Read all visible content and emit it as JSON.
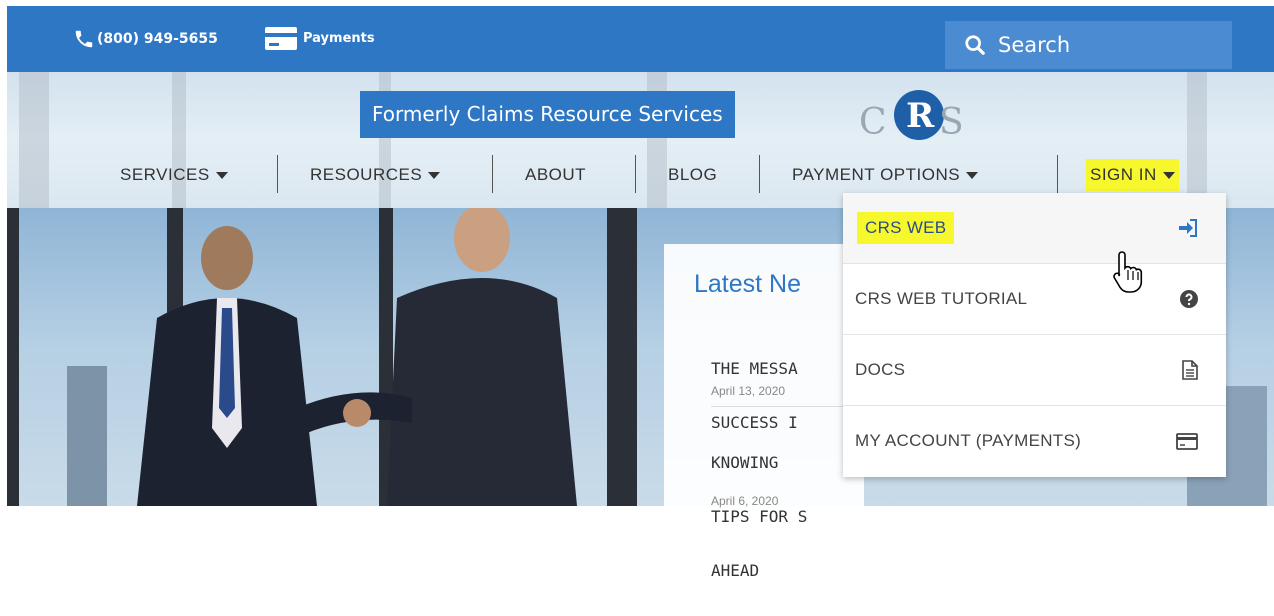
{
  "topbar": {
    "phone": "(800) 949-5655",
    "payments_label": "Payments",
    "search_label": "Search"
  },
  "header": {
    "tagline": "Formerly Claims Resource Services",
    "logo_letters": [
      "C",
      "R",
      "S"
    ]
  },
  "nav": {
    "items": [
      {
        "label": "SERVICES",
        "dropdown": true
      },
      {
        "label": "RESOURCES",
        "dropdown": true
      },
      {
        "label": "ABOUT",
        "dropdown": false
      },
      {
        "label": "BLOG",
        "dropdown": false
      },
      {
        "label": "PAYMENT OPTIONS",
        "dropdown": true
      },
      {
        "label": "SIGN IN",
        "dropdown": true
      }
    ]
  },
  "news": {
    "title": "Latest Ne",
    "items": [
      {
        "line1": "THE MESSA",
        "line2": "SUCCESS I",
        "date": "April 13, 2020"
      },
      {
        "line1": "KNOWING ",
        "line2": "TIPS FOR S",
        "line3": "AHEAD",
        "date": "April 6, 2020"
      }
    ]
  },
  "signin_menu": {
    "items": [
      {
        "label": "CRS WEB",
        "icon": "sign-in-icon"
      },
      {
        "label": "CRS WEB TUTORIAL",
        "icon": "question-circle-icon"
      },
      {
        "label": "DOCS",
        "icon": "document-icon"
      },
      {
        "label": "MY ACCOUNT (PAYMENTS)",
        "icon": "credit-card-icon"
      }
    ]
  },
  "colors": {
    "brand_blue": "#2e77c4",
    "highlight_yellow": "#f7f72e"
  }
}
